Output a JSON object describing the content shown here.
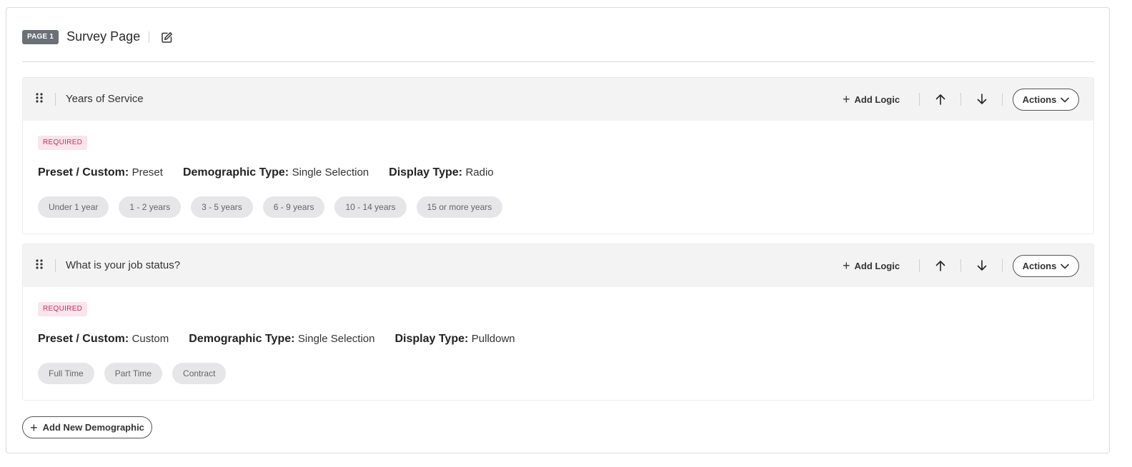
{
  "page": {
    "badge": "PAGE 1",
    "title": "Survey Page"
  },
  "demographics": [
    {
      "title": "Years of Service",
      "add_logic": "Add Logic",
      "actions": "Actions",
      "required": "REQUIRED",
      "preset_label": "Preset / Custom:",
      "preset_value": "Preset",
      "type_label": "Demographic Type:",
      "type_value": "Single Selection",
      "display_label": "Display Type:",
      "display_value": "Radio",
      "options": [
        "Under 1 year",
        "1 - 2 years",
        "3 - 5 years",
        "6 - 9 years",
        "10 - 14 years",
        "15 or more years"
      ]
    },
    {
      "title": "What is your job status?",
      "add_logic": "Add Logic",
      "actions": "Actions",
      "required": "REQUIRED",
      "preset_label": "Preset / Custom:",
      "preset_value": "Custom",
      "type_label": "Demographic Type:",
      "type_value": "Single Selection",
      "display_label": "Display Type:",
      "display_value": "Pulldown",
      "options": [
        "Full Time",
        "Part Time",
        "Contract"
      ]
    }
  ],
  "add_demographic": "Add New Demographic",
  "icons": {
    "edit": "edit-icon",
    "drag": "drag-handle-icon",
    "plus": "plus-icon",
    "up": "arrow-up-icon",
    "down": "arrow-down-icon",
    "chevron": "chevron-down-icon"
  },
  "colors": {
    "page_badge": "#6b6f76",
    "required_bg": "#fbe4ec",
    "required_text": "#c4305f",
    "header_bg": "#f3f3f3",
    "chip_bg": "#e6e6e8"
  }
}
